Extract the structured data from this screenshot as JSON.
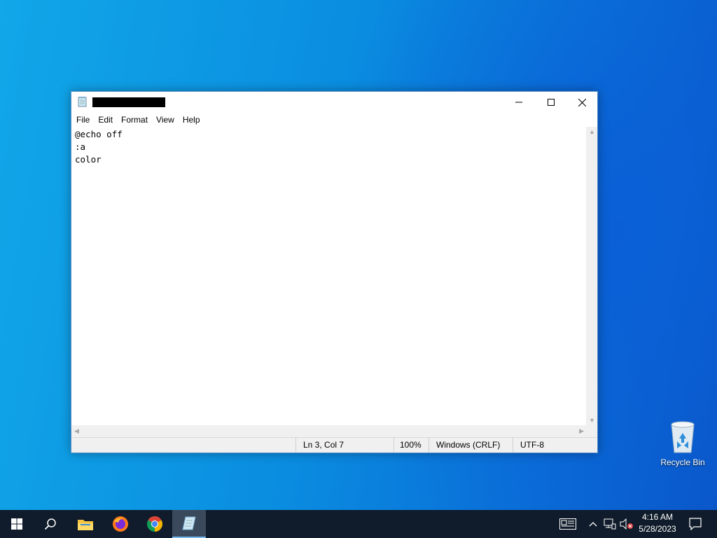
{
  "window": {
    "title": "",
    "menu": [
      "File",
      "Edit",
      "Format",
      "View",
      "Help"
    ],
    "content_lines": [
      "@echo off",
      ":a",
      "color"
    ],
    "status": {
      "position": "Ln 3, Col 7",
      "zoom": "100%",
      "line_ending": "Windows (CRLF)",
      "encoding": "UTF-8"
    }
  },
  "desktop": {
    "icons": [
      {
        "label": "Recycle Bin",
        "icon": "recycle-bin-icon"
      }
    ]
  },
  "taskbar": {
    "apps": [
      "start-icon",
      "search-icon",
      "file-explorer-icon",
      "firefox-icon",
      "chrome-icon",
      "notepad-icon"
    ],
    "clock": {
      "time": "4:16 AM",
      "date": "5/28/2023"
    }
  },
  "colors": {
    "desktop": "#0a8de0",
    "taskbar": "#101c2b",
    "accent": "#76b9ed"
  }
}
